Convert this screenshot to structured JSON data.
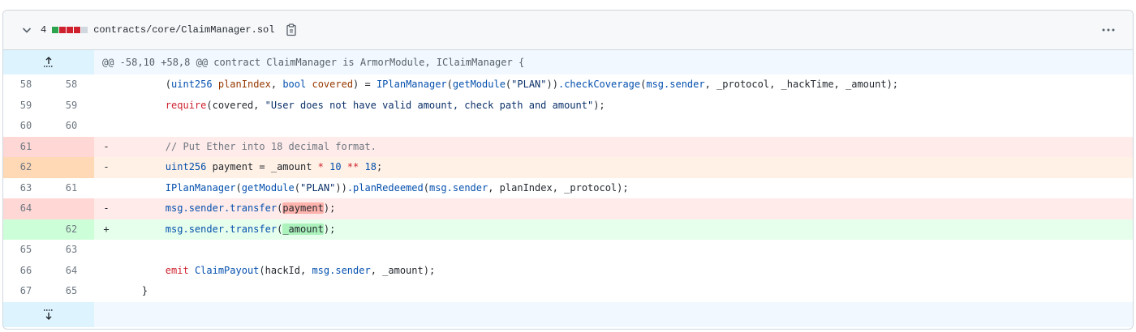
{
  "file": {
    "change_count": "4",
    "path": "contracts/core/ClaimManager.sol",
    "blocks": [
      "#2da44e",
      "#cf222e",
      "#cf222e",
      "#cf222e",
      "#d0d7de"
    ]
  },
  "hunk_header": "@@ -58,10 +58,8 @@ contract ClaimManager is ArmorModule, IClaimManager {",
  "lines": {
    "l1": {
      "old": "58",
      "new": "58",
      "sign": ""
    },
    "l2": {
      "old": "59",
      "new": "59",
      "sign": ""
    },
    "l3": {
      "old": "60",
      "new": "60",
      "sign": ""
    },
    "l4": {
      "old": "61",
      "new": "",
      "sign": "-"
    },
    "l5": {
      "old": "62",
      "new": "",
      "sign": "-"
    },
    "l6": {
      "old": "63",
      "new": "61",
      "sign": ""
    },
    "l7": {
      "old": "64",
      "new": "",
      "sign": "-"
    },
    "l8": {
      "old": "",
      "new": "62",
      "sign": "+"
    },
    "l9": {
      "old": "65",
      "new": "63",
      "sign": ""
    },
    "l10": {
      "old": "66",
      "new": "64",
      "sign": ""
    },
    "l11": {
      "old": "67",
      "new": "65",
      "sign": ""
    }
  },
  "tokens": {
    "l1": [
      "        ",
      "(",
      "uint256",
      " ",
      "planIndex",
      ", ",
      "bool",
      " ",
      "covered",
      ") = ",
      "IPlanManager",
      "(",
      "getModule",
      "(",
      "\"PLAN\"",
      "))",
      ".checkCoverage",
      "(",
      "msg.sender",
      ", _protocol, _hackTime, _amount);"
    ],
    "l2": [
      "        ",
      "require",
      "(covered, ",
      "\"User does not have valid amount, check path and amount\"",
      ");"
    ],
    "l4": [
      "        ",
      "// Put Ether into 18 decimal format."
    ],
    "l5": [
      "        ",
      "uint256",
      " payment = _amount ",
      "*",
      " ",
      "10",
      " ",
      "**",
      " ",
      "18",
      ";"
    ],
    "l6": [
      "        ",
      "IPlanManager",
      "(",
      "getModule",
      "(",
      "\"PLAN\"",
      "))",
      ".planRedeemed",
      "(",
      "msg.sender",
      ", planIndex, _protocol);"
    ],
    "l7": [
      "        ",
      "msg.sender.transfer",
      "(",
      "payment",
      ");"
    ],
    "l8": [
      "        ",
      "msg.sender.transfer",
      "(",
      "_amount",
      ");"
    ],
    "l10": [
      "        ",
      "emit",
      " ",
      "ClaimPayout",
      "(hackId, ",
      "msg.sender",
      ", _amount);"
    ],
    "l11": [
      "    ",
      "}"
    ]
  }
}
